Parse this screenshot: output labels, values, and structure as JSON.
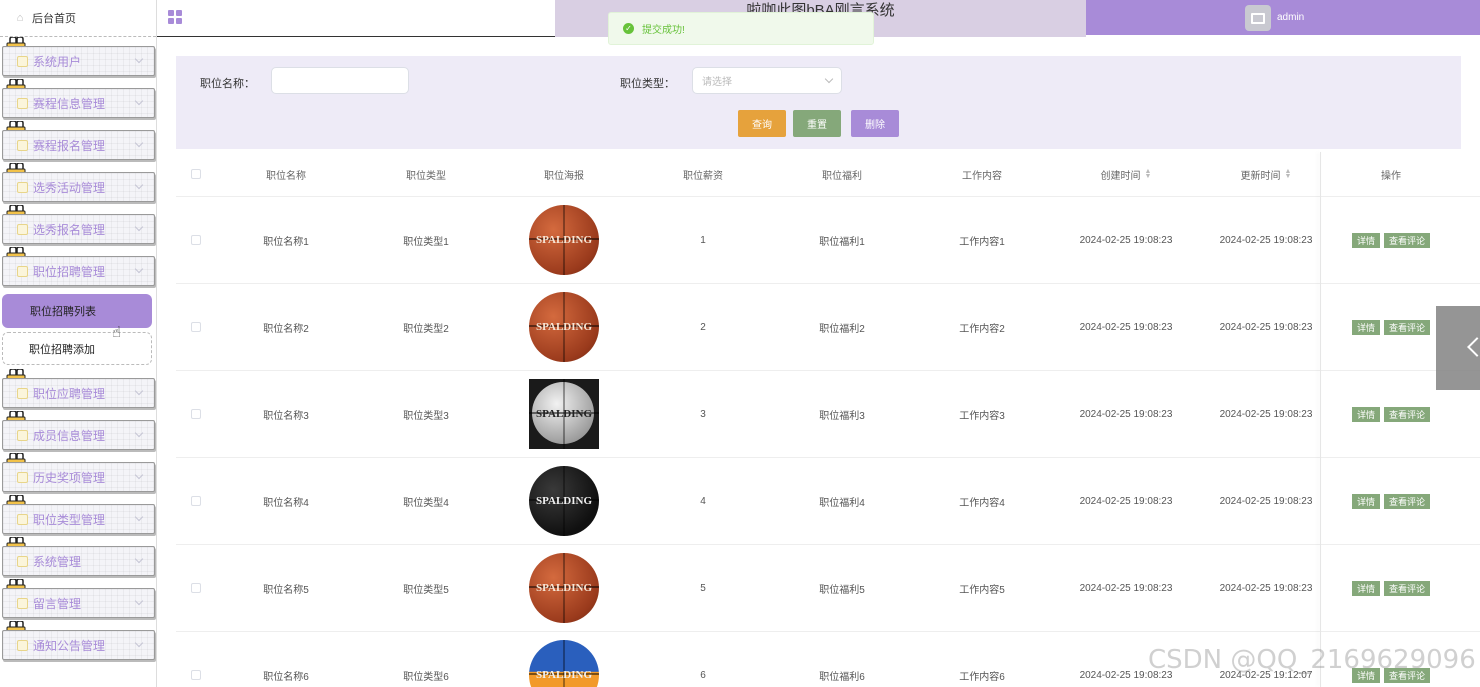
{
  "sidebar": {
    "home_label": "后台首页",
    "menu_top": [
      {
        "label": "系统用户",
        "icon": "user-icon"
      },
      {
        "label": "赛程信息管理",
        "icon": "doc-icon"
      },
      {
        "label": "赛程报名管理",
        "icon": "doc-icon"
      },
      {
        "label": "选秀活动管理",
        "icon": "doc-icon"
      },
      {
        "label": "选秀报名管理",
        "icon": "doc-icon"
      },
      {
        "label": "职位招聘管理",
        "icon": "doc-icon"
      }
    ],
    "sub_active": "职位招聘列表",
    "sub_item": "职位招聘添加",
    "menu_bottom": [
      {
        "label": "职位应聘管理",
        "icon": "doc-icon"
      },
      {
        "label": "成员信息管理",
        "icon": "doc-icon"
      },
      {
        "label": "历史奖项管理",
        "icon": "doc-icon"
      },
      {
        "label": "职位类型管理",
        "icon": "doc-icon"
      },
      {
        "label": "系统管理",
        "icon": "settings-icon"
      },
      {
        "label": "留言管理",
        "icon": "message-icon"
      },
      {
        "label": "通知公告管理",
        "icon": "notice-icon"
      }
    ]
  },
  "header": {
    "title_partial": "啦咖此图bBA刚言系统",
    "user": "admin"
  },
  "toast": {
    "message": "提交成功!"
  },
  "search": {
    "name_label": "职位名称：",
    "name_value": "",
    "type_label": "职位类型：",
    "type_placeholder": "请选择",
    "query_button": "查询",
    "reset_button": "重置",
    "delete_button": "删除"
  },
  "table": {
    "headers": [
      "职位名称",
      "职位类型",
      "职位海报",
      "职位薪资",
      "职位福利",
      "工作内容",
      "创建时间",
      "更新时间",
      "操作"
    ],
    "rows": [
      {
        "name": "职位名称1",
        "type": "职位类型1",
        "salary": "1",
        "welfare": "职位福利1",
        "content": "工作内容1",
        "created": "2024-02-25 19:08:23",
        "updated": "2024-02-25 19:08:23"
      },
      {
        "name": "职位名称2",
        "type": "职位类型2",
        "salary": "2",
        "welfare": "职位福利2",
        "content": "工作内容2",
        "created": "2024-02-25 19:08:23",
        "updated": "2024-02-25 19:08:23"
      },
      {
        "name": "职位名称3",
        "type": "职位类型3",
        "salary": "3",
        "welfare": "职位福利3",
        "content": "工作内容3",
        "created": "2024-02-25 19:08:23",
        "updated": "2024-02-25 19:08:23"
      },
      {
        "name": "职位名称4",
        "type": "职位类型4",
        "salary": "4",
        "welfare": "职位福利4",
        "content": "工作内容4",
        "created": "2024-02-25 19:08:23",
        "updated": "2024-02-25 19:08:23"
      },
      {
        "name": "职位名称5",
        "type": "职位类型5",
        "salary": "5",
        "welfare": "职位福利5",
        "content": "工作内容5",
        "created": "2024-02-25 19:08:23",
        "updated": "2024-02-25 19:08:23"
      },
      {
        "name": "职位名称6",
        "type": "职位类型6",
        "salary": "6",
        "welfare": "职位福利6",
        "content": "工作内容6",
        "created": "2024-02-25 19:08:23",
        "updated": "2024-02-25 19:12:07"
      }
    ],
    "ball_brands": [
      "SPALDING",
      "SPALDING",
      "SPALDING",
      "SPALDING",
      "SPALDING",
      "SPALDING"
    ],
    "op_detail": "详情",
    "op_comment": "查看评论"
  },
  "watermark": "CSDN @QQ_2169629096",
  "colors": {
    "accent": "#a88bd8",
    "query_button": "#e6a23c",
    "reset_button": "#85a87a",
    "delete_button": "#a88bd8",
    "toast_text": "#67c23a"
  }
}
